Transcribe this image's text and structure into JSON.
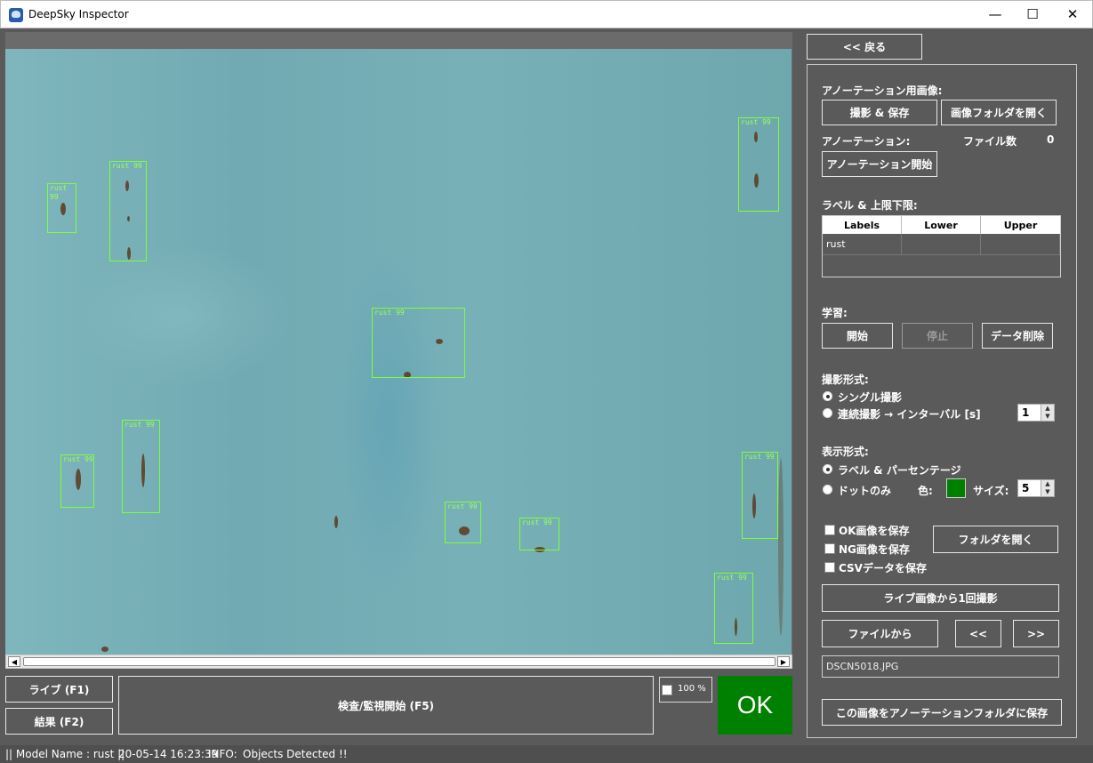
{
  "window": {
    "title": "DeepSky Inspector",
    "minimize": "—",
    "maximize": "☐",
    "close": "✕"
  },
  "detections": {
    "label": "rust 99",
    "count_shown": 11
  },
  "toolbar": {
    "back_label": "<< 戻る",
    "live_label": "ライブ (F1)",
    "result_label": "結果 (F2)",
    "inspect_label": "検査/監視開始 (F5)",
    "zoom_label": "100 %",
    "ok_label": "OK"
  },
  "annotation": {
    "section_title": "アノーテーション用画像:",
    "capture_save_label": "撮影 & 保存",
    "open_image_folder_label": "画像フォルダを開く",
    "annotation_label": "アノーテーション:",
    "file_count_label": "ファイル数",
    "file_count_value": "0",
    "start_annotation_label": "アノーテーション開始"
  },
  "labels_section": {
    "title": "ラベル & 上限下限:",
    "columns": [
      "Labels",
      "Lower",
      "Upper"
    ],
    "rows": [
      [
        "rust",
        "",
        ""
      ]
    ]
  },
  "training": {
    "title": "学習:",
    "start_label": "開始",
    "stop_label": "停止",
    "delete_label": "データ削除"
  },
  "capture_mode": {
    "title": "撮影形式:",
    "single_label": "シングル撮影",
    "continuous_label": "連続撮影 → インターバル [s]",
    "interval_value": "1"
  },
  "display_mode": {
    "title": "表示形式:",
    "label_percent": "ラベル & パーセンテージ",
    "dot_only": "ドットのみ",
    "color_label": "色:",
    "dot_color": "#008000",
    "size_label": "サイズ:",
    "size_value": "5"
  },
  "save_options": {
    "ok_images": "OK画像を保存",
    "ng_images": "NG画像を保存",
    "csv_data": "CSVデータを保存",
    "open_folder_label": "フォルダを開く"
  },
  "capture_once_label": "ライブ画像から1回撮影",
  "from_file_label": "ファイルから",
  "prev_label": "<<",
  "next_label": ">>",
  "current_file": "DSCN5018.JPG",
  "save_to_annotation_label": "この画像をアノーテーションフォルダに保存",
  "status": {
    "model": "|| Model Name : rust ||",
    "timestamp": "20-05-14 16:23:39",
    "info_label": "INFO:",
    "info_message": "Objects Detected !!"
  }
}
